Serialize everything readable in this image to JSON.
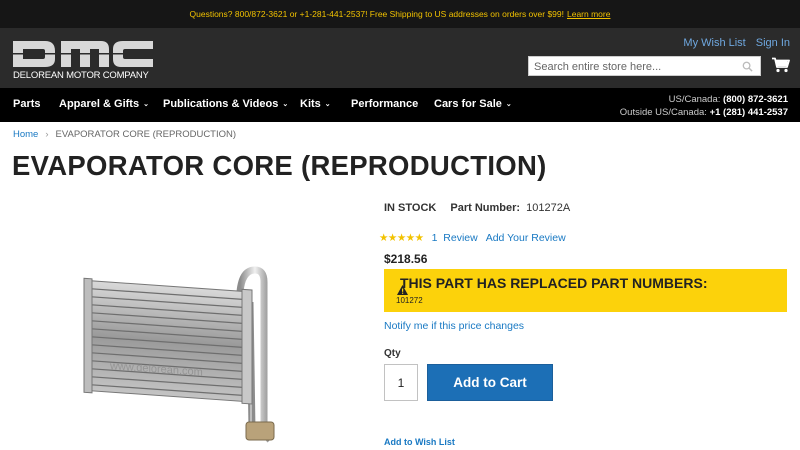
{
  "topbar": {
    "message": "Questions? 800/872-3621 or +1-281-441-2537! Free Shipping to US addresses on orders over $99!",
    "learn_more": "Learn more"
  },
  "header": {
    "logo_text": "DELOREAN MOTOR COMPANY",
    "wishlist_link": "My Wish List",
    "signin_link": "Sign In",
    "search_placeholder": "Search entire store here...",
    "search_icon": "search-icon",
    "cart_icon": "cart-icon"
  },
  "nav": {
    "items": [
      {
        "label": "Parts",
        "has_caret": false
      },
      {
        "label": "Apparel & Gifts",
        "has_caret": true
      },
      {
        "label": "Publications & Videos",
        "has_caret": true
      },
      {
        "label": "Kits",
        "has_caret": true
      },
      {
        "label": "Performance",
        "has_caret": false
      },
      {
        "label": "Cars for Sale",
        "has_caret": true
      }
    ],
    "caret": "⌄",
    "phone_us_label": "US/Canada:",
    "phone_us": "(800) 872-3621",
    "phone_intl_label": "Outside US/Canada:",
    "phone_intl": "+1 (281) 441-2537"
  },
  "breadcrumb": {
    "home": "Home",
    "separator": "›",
    "current": "EVAPORATOR CORE (REPRODUCTION)"
  },
  "product": {
    "title": "EVAPORATOR CORE (REPRODUCTION)",
    "stock": "IN STOCK",
    "part_number_label": "Part Number:",
    "part_number": "101272A",
    "stars": "★★★★★",
    "rating": 5,
    "review_count": "1",
    "review_label": "Review",
    "add_review": "Add Your Review",
    "price": "$218.56",
    "replaced_heading": "THIS PART HAS REPLACED PART NUMBERS:",
    "replaced_parts": "101272",
    "notify_link": "Notify me if this price changes",
    "qty_label": "Qty",
    "qty_value": "1",
    "add_to_cart": "Add to Cart",
    "add_to_wishlist": "Add to Wish List",
    "image_watermark": "www.delorean.com"
  },
  "colors": {
    "topbar_bg": "#161616",
    "topbar_text": "#f2c200",
    "header_bg": "#2b2b2b",
    "nav_bg": "#000000",
    "link": "#1979c3",
    "notice_bg": "#fcd20b",
    "button_bg": "#1c6fb6"
  }
}
